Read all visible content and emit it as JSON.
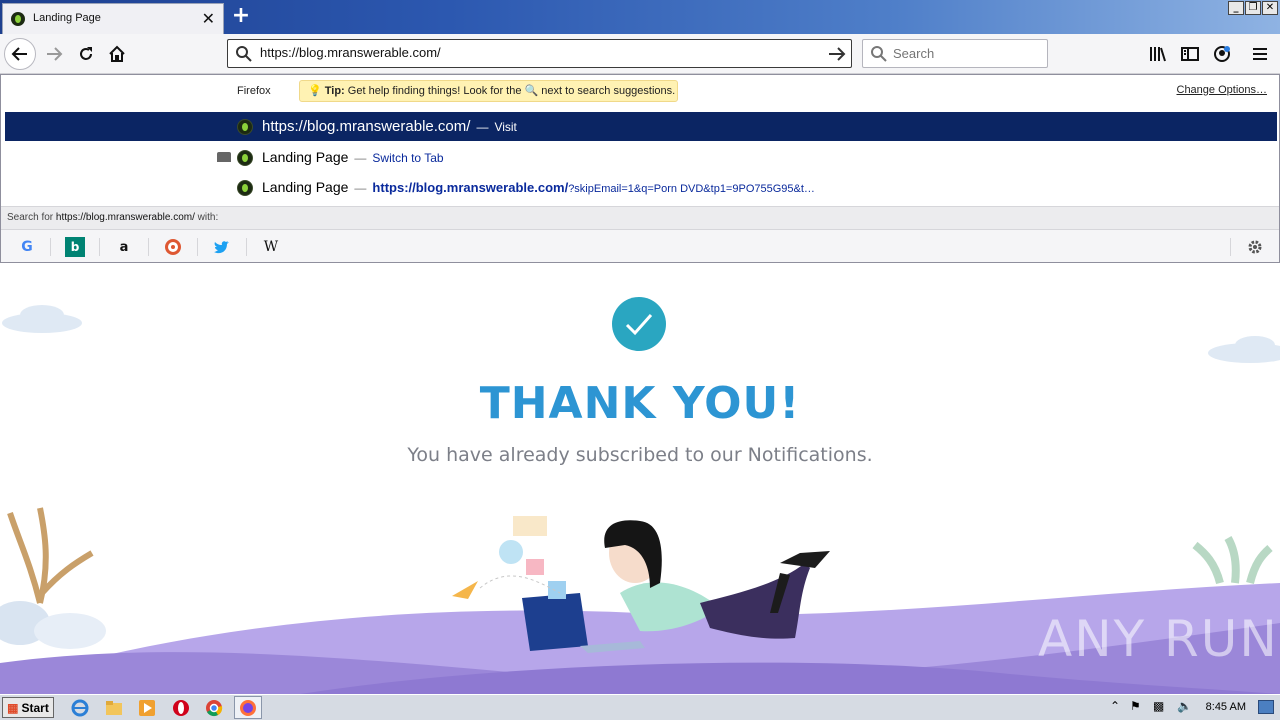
{
  "window": {
    "tab_title": "Landing Page",
    "min_label": "_",
    "max_label": "❐",
    "close_label": "✕"
  },
  "navbar": {
    "url": "https://blog.mranswerable.com/",
    "search_placeholder": "Search"
  },
  "popup": {
    "firefox_label": "Firefox",
    "tip_bold": "Tip:",
    "tip_text": "Get help finding things! Look for the",
    "tip_text2": "next to search suggestions.",
    "change_options": "Change Options…",
    "results": [
      {
        "title": "https://blog.mranswerable.com/",
        "sep": "—",
        "action": "Visit"
      },
      {
        "title": "Landing Page",
        "sep": "—",
        "action": "Switch to Tab"
      },
      {
        "title": "Landing Page",
        "sep": "—",
        "url_bold": "https://blog.mranswerable.com/",
        "url_rest": "?skipEmail=1&q=Porn DVD&tp1=9PO755G95&t…"
      }
    ],
    "search_for_prefix": "Search for",
    "search_for_query": "https://blog.mranswerable.com/",
    "search_for_suffix": "with:",
    "engines": [
      "google-icon",
      "bing-icon",
      "amazon-icon",
      "duckduckgo-icon",
      "twitter-icon",
      "wikipedia-icon"
    ]
  },
  "page": {
    "heading": "THANK YOU!",
    "subtext": "You have already subscribed to our Notifications."
  },
  "taskbar": {
    "start_label": "Start",
    "clock": "8:45 AM"
  },
  "watermark": "ANY RUN",
  "colors": {
    "heading": "#2d95d3",
    "check_circle": "#2aa6c1",
    "selected_row": "#0b2563",
    "hill": "#9b87d9"
  }
}
